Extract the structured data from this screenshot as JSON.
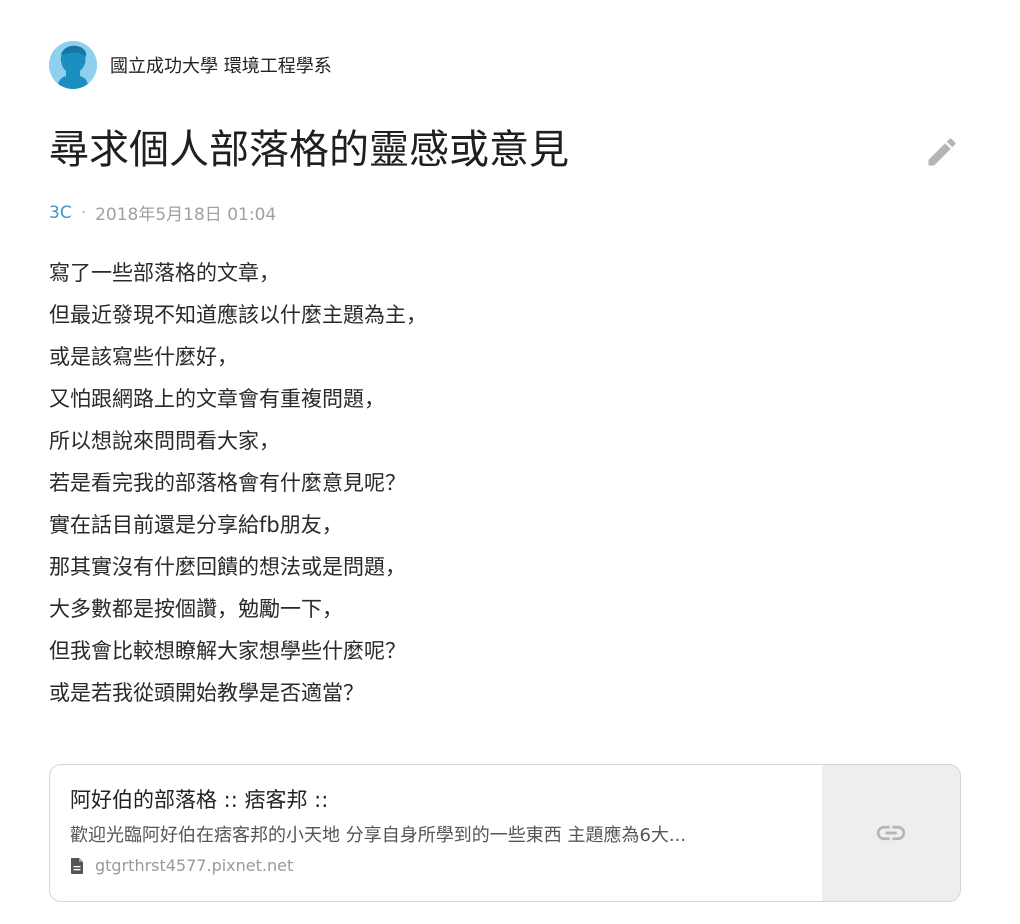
{
  "author": {
    "name": "國立成功大學 環境工程學系",
    "avatar_bg": "#8ed0ee",
    "avatar_fg": "#1c8fc0"
  },
  "post": {
    "title": "尋求個人部落格的靈感或意見",
    "category": "3C",
    "separator": "·",
    "timestamp": "2018年5月18日 01:04",
    "edit_icon": "pencil-icon",
    "lines": [
      "寫了一些部落格的文章，",
      "但最近發現不知道應該以什麼主題為主，",
      "或是該寫些什麼好，",
      "又怕跟網路上的文章會有重複問題，",
      "所以想說來問問看大家，",
      "若是看完我的部落格會有什麼意見呢？",
      "實在話目前還是分享給fb朋友，",
      "那其實沒有什麼回饋的想法或是問題，",
      "大多數都是按個讚，勉勵一下，",
      "但我會比較想瞭解大家想學些什麼呢？",
      "或是若我從頭開始教學是否適當？"
    ]
  },
  "link_card": {
    "title": "阿好伯的部落格 :: 痞客邦 ::",
    "description": "歡迎光臨阿好伯在痞客邦的小天地 分享自身所學到的一些東西 主題應為6大...",
    "domain": "gtgrthrst4577.pixnet.net",
    "domain_icon": "document-icon",
    "thumb_icon": "link-icon"
  },
  "colors": {
    "category": "#3d97c2",
    "meta": "#a0a0a0",
    "icon_gray": "#b5b5b5",
    "card_border": "#d6d6d6",
    "thumb_bg": "#eeeeee"
  }
}
